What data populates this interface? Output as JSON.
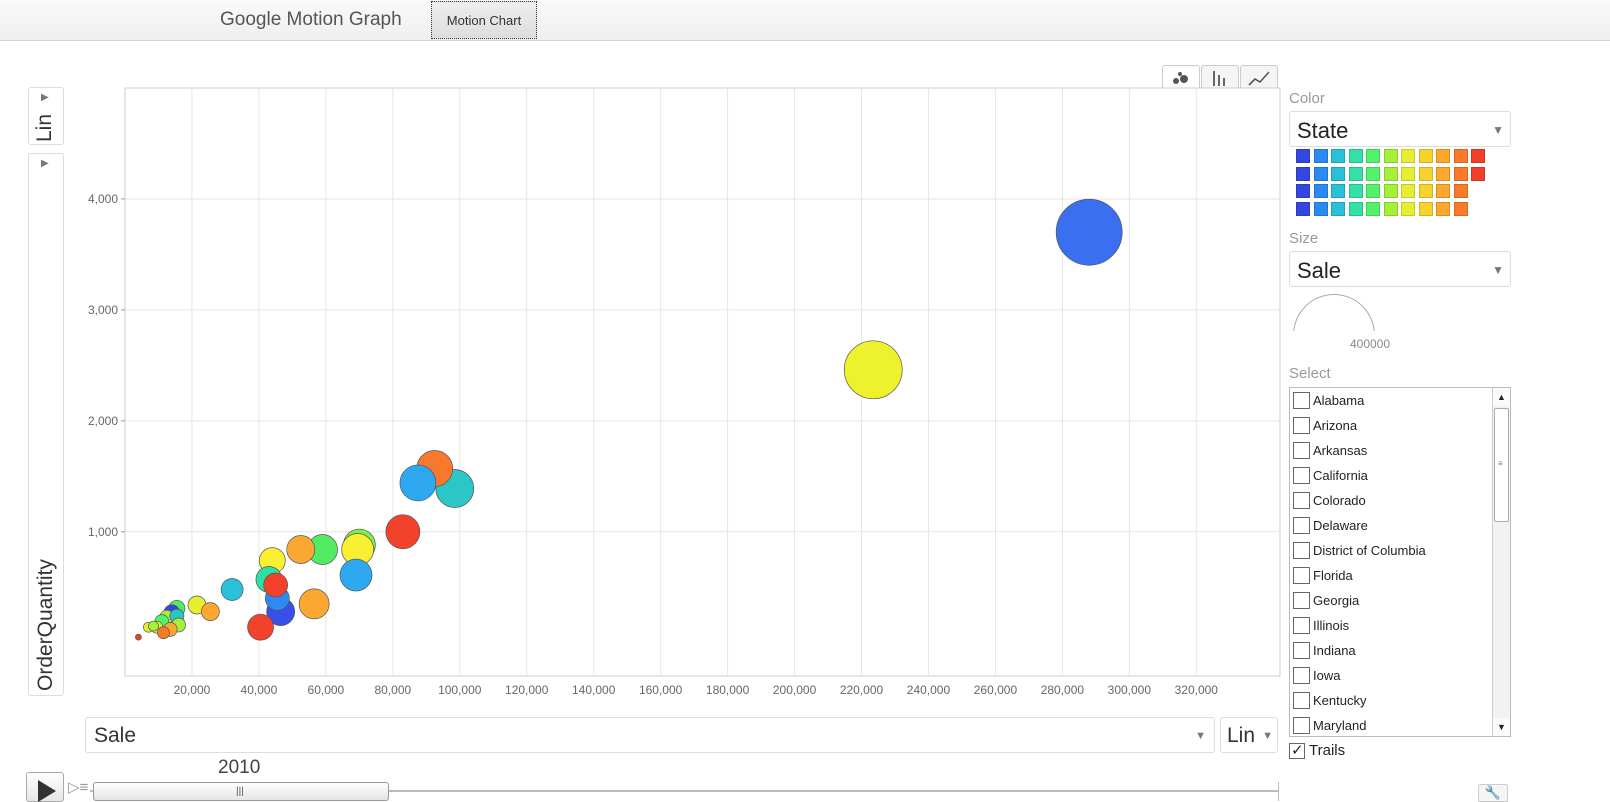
{
  "app": {
    "title": "Google Motion Graph",
    "tab_label": "Motion Chart"
  },
  "y_axis": {
    "scale": "Lin",
    "variable": "OrderQuantity"
  },
  "x_axis": {
    "variable": "Sale",
    "scale": "Lin"
  },
  "timeline": {
    "year": "2010"
  },
  "panel": {
    "color_label": "Color",
    "color_value": "State",
    "size_label": "Size",
    "size_value": "Sale",
    "size_legend_value": "400000",
    "select_label": "Select",
    "trails_label": "Trails",
    "trails_checked": true
  },
  "select_items": [
    "Alabama",
    "Arizona",
    "Arkansas",
    "California",
    "Colorado",
    "Delaware",
    "District of Columbia",
    "Florida",
    "Georgia",
    "Illinois",
    "Indiana",
    "Iowa",
    "Kentucky",
    "Maryland"
  ],
  "swatch_colors": [
    [
      "#3347e0",
      "#2b8af2",
      "#29c0d9",
      "#33e0a6",
      "#52f26a",
      "#a5f03a",
      "#e5ef2f",
      "#f8d22c",
      "#fba82c",
      "#f87a2a",
      "#f23f2a"
    ],
    [
      "#3347e0",
      "#2b8af2",
      "#29c0d9",
      "#33e0a6",
      "#52f26a",
      "#a5f03a",
      "#e5ef2f",
      "#f8d22c",
      "#fba82c",
      "#f87a2a",
      "#f23f2a"
    ],
    [
      "#3347e0",
      "#2b8af2",
      "#29c0d9",
      "#33e0a6",
      "#52f26a",
      "#a5f03a",
      "#e5ef2f",
      "#f8d22c",
      "#fba82c",
      "#f87a2a"
    ],
    [
      "#3347e0",
      "#2b8af2",
      "#29c0d9",
      "#33e0a6",
      "#52f26a",
      "#a5f03a",
      "#e5ef2f",
      "#f8d22c",
      "#fba82c",
      "#f87a2a"
    ]
  ],
  "chart_data": {
    "type": "scatter",
    "xlabel": "Sale",
    "ylabel": "OrderQuantity",
    "xlim": [
      0,
      345000
    ],
    "ylim": [
      -300,
      5000
    ],
    "x_ticks": [
      20000,
      40000,
      60000,
      80000,
      100000,
      120000,
      140000,
      160000,
      180000,
      200000,
      220000,
      240000,
      260000,
      280000,
      300000,
      320000
    ],
    "x_tick_labels": [
      "20,000",
      "40,000",
      "60,000",
      "80,000",
      "100,000",
      "120,000",
      "140,000",
      "160,000",
      "180,000",
      "200,000",
      "220,000",
      "240,000",
      "260,000",
      "280,000",
      "300,000",
      "320,000"
    ],
    "y_ticks": [
      1000,
      2000,
      3000,
      4000
    ],
    "y_tick_labels": [
      "1,000",
      "2,000",
      "3,000",
      "4,000"
    ],
    "grid": true,
    "points": [
      {
        "x": 288000,
        "y": 3700,
        "r": 33,
        "color": "#3a6ff2"
      },
      {
        "x": 223500,
        "y": 2460,
        "r": 29,
        "color": "#eef22c"
      },
      {
        "x": 92500,
        "y": 1570,
        "r": 18,
        "color": "#f8782c"
      },
      {
        "x": 98500,
        "y": 1390,
        "r": 19,
        "color": "#2cc6c6"
      },
      {
        "x": 87500,
        "y": 1440,
        "r": 18,
        "color": "#2ea8f0"
      },
      {
        "x": 83000,
        "y": 1000,
        "r": 17,
        "color": "#f2422c"
      },
      {
        "x": 70000,
        "y": 880,
        "r": 16,
        "color": "#7ef04a"
      },
      {
        "x": 69500,
        "y": 840,
        "r": 16,
        "color": "#f8f030"
      },
      {
        "x": 69000,
        "y": 610,
        "r": 16,
        "color": "#2ea8f0"
      },
      {
        "x": 59000,
        "y": 840,
        "r": 15,
        "color": "#52ec62"
      },
      {
        "x": 52500,
        "y": 840,
        "r": 14,
        "color": "#fba832"
      },
      {
        "x": 56500,
        "y": 350,
        "r": 15,
        "color": "#fba832"
      },
      {
        "x": 44000,
        "y": 740,
        "r": 13,
        "color": "#f8f030"
      },
      {
        "x": 46500,
        "y": 280,
        "r": 14,
        "color": "#3a4fe8"
      },
      {
        "x": 45500,
        "y": 400,
        "r": 12,
        "color": "#2e8af2"
      },
      {
        "x": 45000,
        "y": 520,
        "r": 12,
        "color": "#f2422c"
      },
      {
        "x": 43000,
        "y": 570,
        "r": 13,
        "color": "#2ee0a2"
      },
      {
        "x": 40500,
        "y": 140,
        "r": 13,
        "color": "#f2422c"
      },
      {
        "x": 32000,
        "y": 480,
        "r": 11,
        "color": "#29c0d9"
      },
      {
        "x": 21500,
        "y": 340,
        "r": 9,
        "color": "#e5ef2f"
      },
      {
        "x": 25500,
        "y": 280,
        "r": 9,
        "color": "#fba832"
      },
      {
        "x": 15500,
        "y": 310,
        "r": 8,
        "color": "#52ec62"
      },
      {
        "x": 14000,
        "y": 270,
        "r": 8,
        "color": "#3347e0"
      },
      {
        "x": 12500,
        "y": 230,
        "r": 7,
        "color": "#a5f03a"
      },
      {
        "x": 15500,
        "y": 240,
        "r": 7,
        "color": "#2cc6c6"
      },
      {
        "x": 11000,
        "y": 190,
        "r": 7,
        "color": "#52f26a"
      },
      {
        "x": 16000,
        "y": 160,
        "r": 7,
        "color": "#a5f03a"
      },
      {
        "x": 13500,
        "y": 120,
        "r": 7,
        "color": "#fba832"
      },
      {
        "x": 9500,
        "y": 140,
        "r": 6,
        "color": "#e5ef2f"
      },
      {
        "x": 11500,
        "y": 90,
        "r": 6,
        "color": "#f87a2a"
      },
      {
        "x": 7000,
        "y": 140,
        "r": 5,
        "color": "#e5ef2f"
      },
      {
        "x": 8500,
        "y": 150,
        "r": 5,
        "color": "#a5f03a"
      },
      {
        "x": 4000,
        "y": 50,
        "r": 3,
        "color": "#f23f2a"
      }
    ]
  }
}
